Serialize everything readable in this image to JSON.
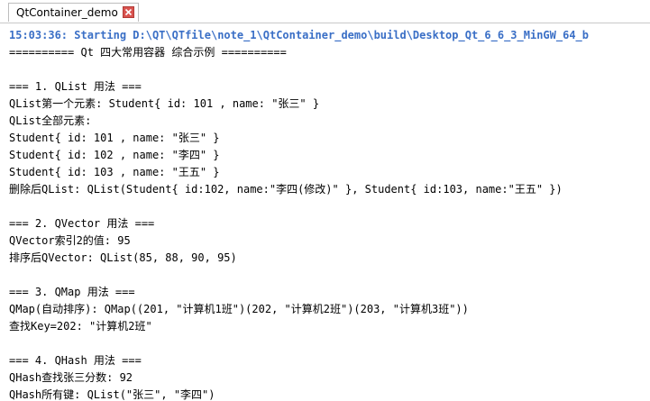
{
  "tab": {
    "title": "QtContainer_demo"
  },
  "output": {
    "lines": [
      {
        "text": "15:03:36: Starting D:\\QT\\QTfile\\note_1\\QtContainer_demo\\build\\Desktop_Qt_6_6_3_MinGW_64_b",
        "style": "blue"
      },
      {
        "text": "========== Qt 四大常用容器 综合示例 =========="
      },
      {
        "text": ""
      },
      {
        "text": "=== 1. QList 用法 ==="
      },
      {
        "text": "QList第一个元素: Student{ id: 101 , name: \"张三\" }"
      },
      {
        "text": "QList全部元素:"
      },
      {
        "text": "Student{ id: 101 , name: \"张三\" }"
      },
      {
        "text": "Student{ id: 102 , name: \"李四\" }"
      },
      {
        "text": "Student{ id: 103 , name: \"王五\" }"
      },
      {
        "text": "删除后QList: QList(Student{ id:102, name:\"李四(修改)\" }, Student{ id:103, name:\"王五\" })"
      },
      {
        "text": ""
      },
      {
        "text": "=== 2. QVector 用法 ==="
      },
      {
        "text": "QVector索引2的值: 95"
      },
      {
        "text": "排序后QVector: QList(85, 88, 90, 95)"
      },
      {
        "text": ""
      },
      {
        "text": "=== 3. QMap 用法 ==="
      },
      {
        "text": "QMap(自动排序): QMap((201, \"计算机1班\")(202, \"计算机2班\")(203, \"计算机3班\"))"
      },
      {
        "text": "查找Key=202: \"计算机2班\""
      },
      {
        "text": ""
      },
      {
        "text": "=== 4. QHash 用法 ==="
      },
      {
        "text": "QHash查找张三分数: 92"
      },
      {
        "text": "QHash所有键: QList(\"张三\", \"李四\")"
      }
    ]
  },
  "colors": {
    "timestamp_line": "#3a6fc6",
    "close_button": "#d9534f"
  },
  "icons": {
    "close": "close-icon"
  }
}
